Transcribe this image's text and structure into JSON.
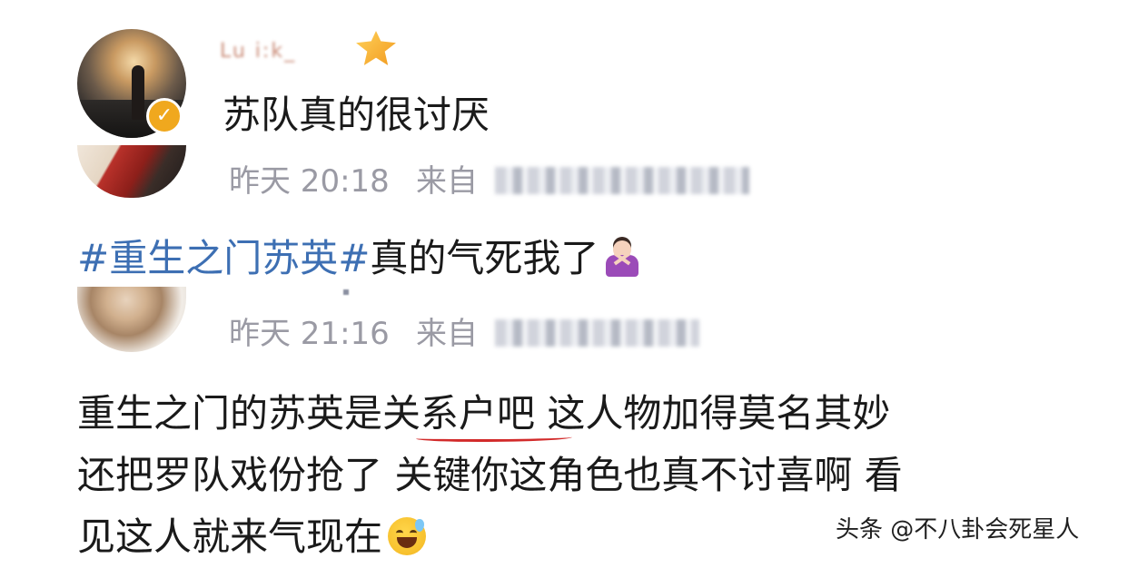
{
  "post": {
    "username": "Lu i:k_",
    "text": "苏队真的很讨厌",
    "verified_icon": "verified-v-icon",
    "vip_icon": "vip-crown-icon"
  },
  "comments": [
    {
      "time": "昨天 20:18",
      "from_label": "来自",
      "text_hashtag": "#重生之门苏英#",
      "text_rest": "真的气死我了",
      "emoji": "woman-gesturing-no-icon"
    },
    {
      "time": "昨天 21:16",
      "from_label": "来自",
      "lines": [
        "重生之门的苏英是关系户吧 这人物加得莫名其妙",
        "还把罗队戏份抢了 关键你这角色也真不讨喜啊 看",
        "见这人就来气现在"
      ],
      "emoji": "grinning-sweat-icon",
      "highlight": "关系户"
    }
  ],
  "watermark": "头条 @不八卦会死星人",
  "colors": {
    "hashtag": "#3d6fb3",
    "meta": "#9a9aa4",
    "underline": "#d22a2a"
  }
}
